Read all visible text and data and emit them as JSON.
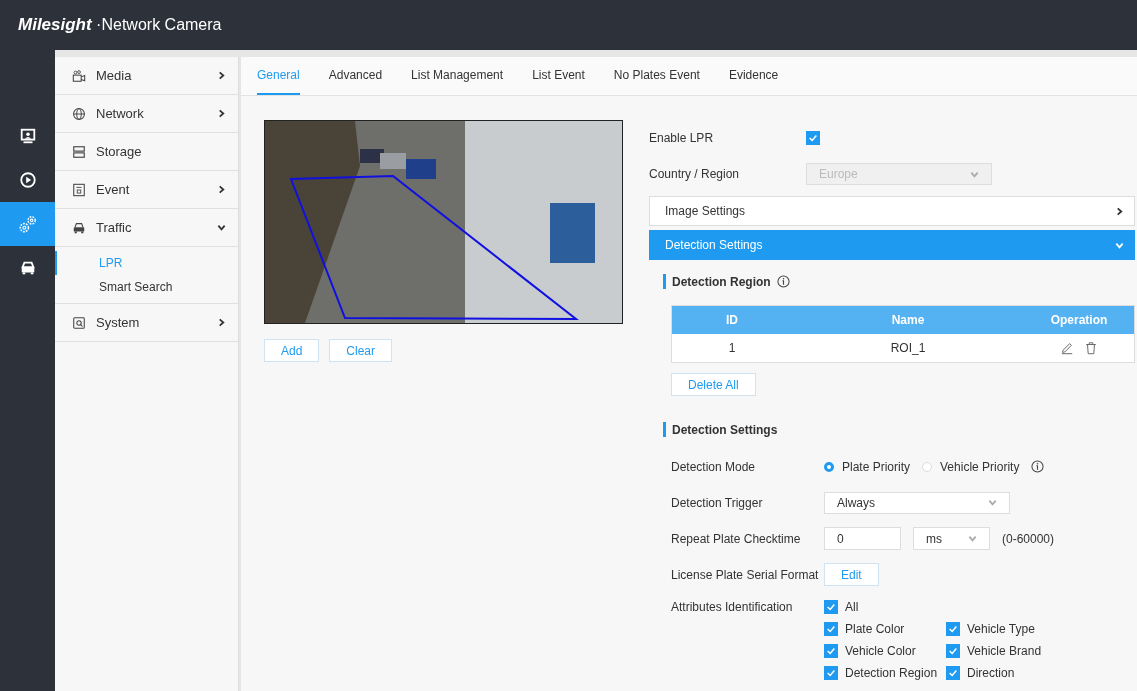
{
  "header": {
    "brand": "Milesight",
    "product": "·Network Camera"
  },
  "rail": [
    {
      "kind": "live",
      "selected": false
    },
    {
      "kind": "playback",
      "selected": false
    },
    {
      "kind": "settings",
      "selected": true
    },
    {
      "kind": "vehicle",
      "selected": false
    }
  ],
  "sidebar": {
    "items": [
      {
        "kind": "media",
        "label": "Media",
        "has_submenu": true,
        "expanded": false
      },
      {
        "kind": "network",
        "label": "Network",
        "has_submenu": true,
        "expanded": false
      },
      {
        "kind": "storage",
        "label": "Storage",
        "has_submenu": false
      },
      {
        "kind": "event",
        "label": "Event",
        "has_submenu": true,
        "expanded": false
      },
      {
        "kind": "traffic",
        "label": "Traffic",
        "has_submenu": true,
        "expanded": true,
        "children": [
          {
            "label": "LPR",
            "selected": true
          },
          {
            "label": "Smart Search",
            "selected": false
          }
        ]
      },
      {
        "kind": "system",
        "label": "System",
        "has_submenu": true,
        "expanded": false
      }
    ]
  },
  "tabs": [
    {
      "label": "General",
      "selected": true
    },
    {
      "label": "Advanced",
      "selected": false
    },
    {
      "label": "List Management",
      "selected": false
    },
    {
      "label": "List Event",
      "selected": false
    },
    {
      "label": "No Plates Event",
      "selected": false
    },
    {
      "label": "Evidence",
      "selected": false
    }
  ],
  "preview": {
    "buttons": [
      "Add",
      "Clear"
    ]
  },
  "enable_lpr": {
    "label": "Enable LPR",
    "checked": true
  },
  "country": {
    "label": "Country / Region",
    "value": "Europe",
    "disabled": true
  },
  "panels": [
    {
      "title": "Image Settings",
      "expanded": false
    },
    {
      "title": "Detection Settings",
      "expanded": true
    }
  ],
  "detection_region": {
    "title": "Detection Region",
    "table": {
      "columns": [
        "ID",
        "Name",
        "Operation"
      ],
      "rows": [
        {
          "id": "1",
          "name": "ROI_1"
        }
      ]
    },
    "delete_all": "Delete All"
  },
  "detection_settings": {
    "title": "Detection Settings",
    "mode": {
      "label": "Detection Mode",
      "options": [
        {
          "label": "Plate Priority",
          "selected": true
        },
        {
          "label": "Vehicle Priority",
          "selected": false
        }
      ]
    },
    "trigger": {
      "label": "Detection Trigger",
      "value": "Always"
    },
    "repeat": {
      "label": "Repeat Plate Checktime",
      "value": "0",
      "unit": "ms",
      "range": "(0-60000)"
    },
    "serial_format": {
      "label": "License Plate Serial Format",
      "button": "Edit"
    },
    "attributes": {
      "label": "Attributes Identification",
      "options": [
        {
          "label": "All",
          "checked": true
        },
        {
          "label": "Plate Color",
          "checked": true
        },
        {
          "label": "Vehicle Type",
          "checked": true
        },
        {
          "label": "Vehicle Color",
          "checked": true
        },
        {
          "label": "Vehicle Brand",
          "checked": true
        },
        {
          "label": "Detection Region",
          "checked": true
        },
        {
          "label": "Direction",
          "checked": true
        }
      ]
    }
  }
}
